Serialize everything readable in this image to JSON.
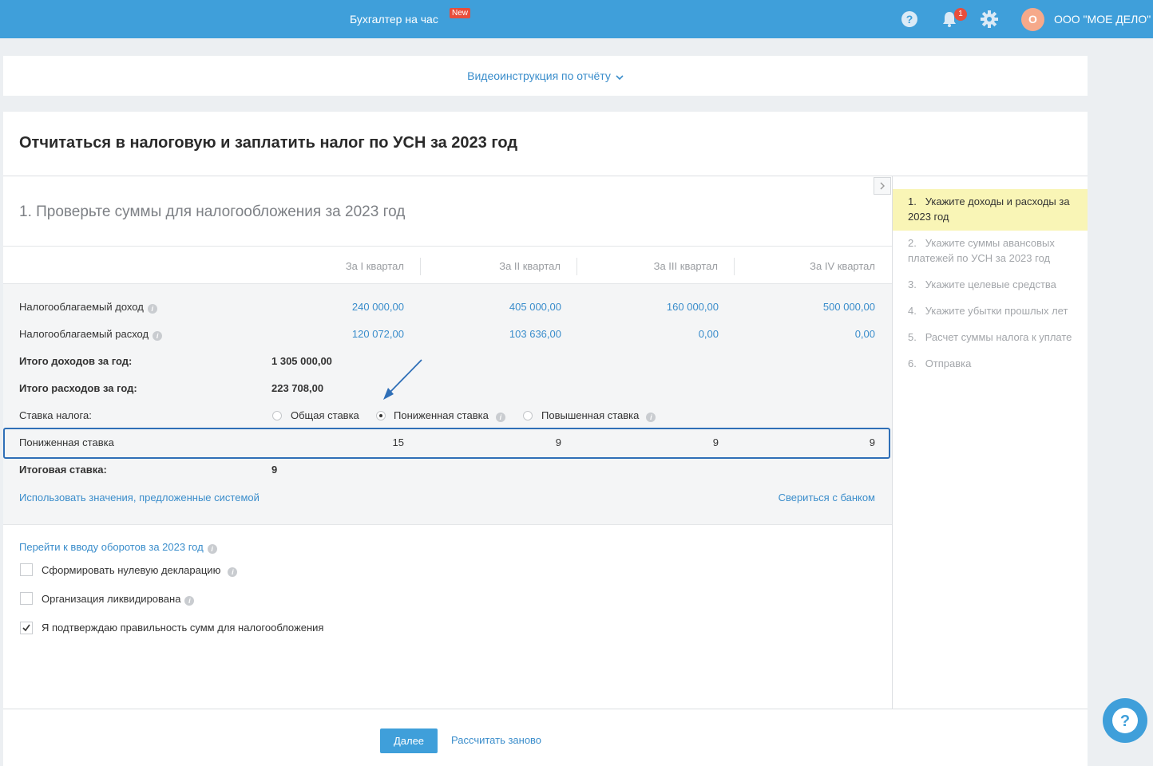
{
  "topbar": {
    "center_link": "Бухгалтер на час",
    "new_badge": "New",
    "notifications_count": "1",
    "avatar_letter": "О",
    "company_name": "ООО \"МОЕ ДЕЛО\""
  },
  "video": {
    "link": "Видеоинструкция по отчёту"
  },
  "page": {
    "title": "Отчитаться в налоговую и заплатить налог по УСН за 2023 год",
    "step_title": "1. Проверьте суммы для налогообложения за 2023 год"
  },
  "table": {
    "quarters": [
      "За I квартал",
      "За II квартал",
      "За III квартал",
      "За IV квартал"
    ],
    "income_label": "Налогооблагаемый доход",
    "income": [
      "240 000,00",
      "405 000,00",
      "160 000,00",
      "500 000,00"
    ],
    "expense_label": "Налогооблагаемый расход",
    "expense": [
      "120 072,00",
      "103 636,00",
      "0,00",
      "0,00"
    ],
    "total_income_label": "Итого доходов за год:",
    "total_income": "1 305 000,00",
    "total_expense_label": "Итого расходов за год:",
    "total_expense": "223 708,00",
    "rate_label": "Ставка налога:",
    "rate_options": [
      "Общая ставка",
      "Пониженная ставка",
      "Повышенная ставка"
    ],
    "rate_selected": "Пониженная ставка",
    "reduced_label": "Пониженная ставка",
    "reduced": [
      "15",
      "9",
      "9",
      "9"
    ],
    "final_rate_label": "Итоговая ставка:",
    "final_rate": "9",
    "use_system_values": "Использовать значения, предложенные системой",
    "check_bank": "Свериться с банком"
  },
  "options": {
    "turnover_link": "Перейти к вводу оборотов за 2023 год",
    "zero_declaration": "Сформировать нулевую декларацию",
    "liquidated": "Организация ликвидирована",
    "confirm": "Я подтверждаю правильность сумм для налогообложения",
    "confirm_checked": true
  },
  "steps": [
    {
      "num": "1.",
      "text": "Укажите доходы и расходы за 2023 год",
      "active": true
    },
    {
      "num": "2.",
      "text": "Укажите суммы авансовых платежей по УСН за 2023 год",
      "active": false
    },
    {
      "num": "3.",
      "text": "Укажите целевые средства",
      "active": false
    },
    {
      "num": "4.",
      "text": "Укажите убытки прошлых лет",
      "active": false
    },
    {
      "num": "5.",
      "text": "Расчет суммы налога к уплате",
      "active": false
    },
    {
      "num": "6.",
      "text": "Отправка",
      "active": false
    }
  ],
  "buttons": {
    "next": "Далее",
    "recalculate": "Рассчитать заново"
  },
  "colors": {
    "topbar": "#3f9fda",
    "link": "#3a8dcb",
    "active_step": "#f9f5b6",
    "highlight_border": "#2f6fb7"
  }
}
